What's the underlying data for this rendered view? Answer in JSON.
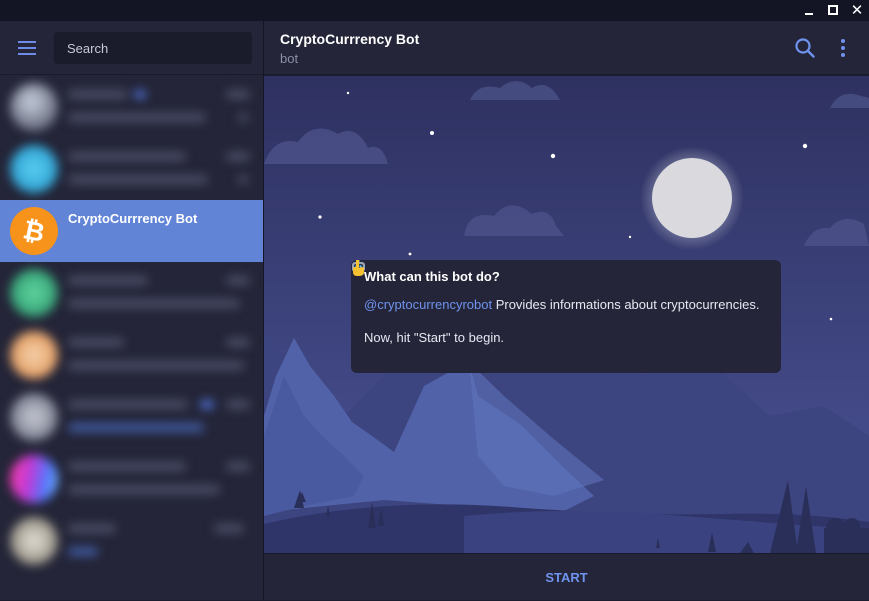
{
  "window": {
    "controls": {
      "minimize": "minimize",
      "maximize": "maximize",
      "close": "✕"
    }
  },
  "sidebar": {
    "search": {
      "placeholder": "Search",
      "value": ""
    },
    "active_chat": {
      "name": "CryptoCurrrency Bot"
    }
  },
  "chat": {
    "title": "CryptoCurrrency Bot",
    "subtitle": "bot",
    "card": {
      "question": "What can this bot do?",
      "mention": "@cryptocurrencyrobot",
      "description": "Provides informations about cryptocurrencies.",
      "hint_before": "Now, hit \"Start\"",
      "hint_after": "to begin."
    },
    "start_label": "START"
  },
  "colors": {
    "accent": "#6284d6",
    "link": "#6f93ef",
    "bitcoin": "#f7931a",
    "panel": "#242538",
    "wallpaper_sky": "#3a3f74"
  },
  "icons": [
    "menu-icon",
    "search-icon",
    "more-vertical-icon",
    "bitcoin-icon",
    "robot-emoji-icon",
    "pointing-down-emoji-icon"
  ]
}
